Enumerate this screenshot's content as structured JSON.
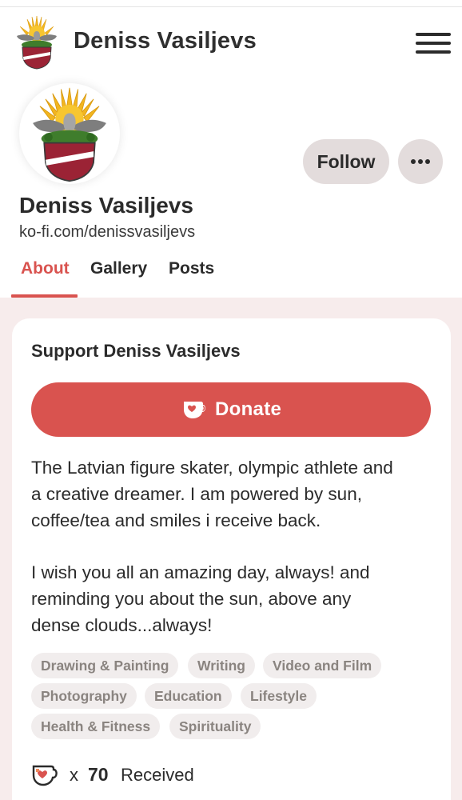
{
  "header": {
    "site_title": "Deniss Vasiljevs",
    "logo_icon": "sun-crest-logo-icon",
    "menu_icon": "hamburger-menu-icon"
  },
  "profile": {
    "name": "Deniss Vasiljevs",
    "url": "ko-fi.com/denissvasiljevs",
    "follow_label": "Follow",
    "more_icon": "more-options-icon"
  },
  "tabs": [
    {
      "label": "About",
      "active": true
    },
    {
      "label": "Gallery",
      "active": false
    },
    {
      "label": "Posts",
      "active": false
    }
  ],
  "support": {
    "title": "Support Deniss Vasiljevs",
    "donate_label": "Donate",
    "donate_icon": "coffee-cup-icon",
    "bio_paragraphs": [
      [
        "The Latvian figure skater, olympic athlete and",
        "a creative dreamer. I am powered by sun,",
        "coffee/tea and smiles i receive back."
      ],
      [
        "I wish you all an amazing day, always! and",
        "reminding you about the sun, above any",
        "dense clouds...always!"
      ]
    ],
    "tags": [
      "Drawing & Painting",
      "Writing",
      "Video and Film",
      "Photography",
      "Education",
      "Lifestyle",
      "Health & Fitness",
      "Spirituality"
    ],
    "received": {
      "multiplier": "x",
      "count": "70",
      "label": "Received"
    }
  },
  "colors": {
    "accent": "#d9534f",
    "pink_background": "#f7ecec",
    "tag_background": "#f1eded",
    "button_gray": "#e3dcdc"
  }
}
